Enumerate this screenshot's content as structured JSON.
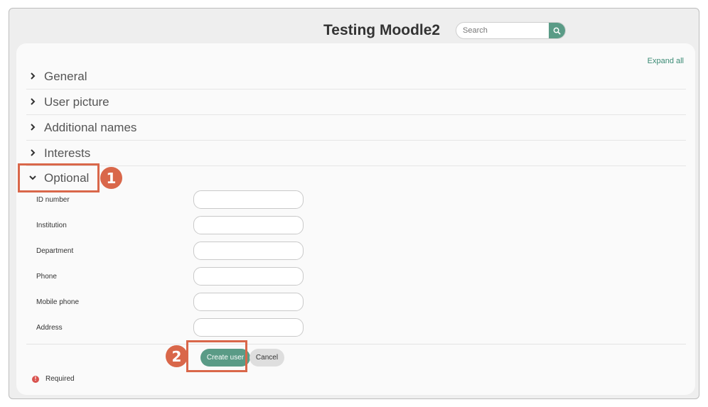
{
  "header": {
    "site_title": "Testing Moodle2",
    "search_placeholder": "Search"
  },
  "form": {
    "expand_all": "Expand all",
    "sections": [
      {
        "label": "General",
        "expanded": false
      },
      {
        "label": "User picture",
        "expanded": false
      },
      {
        "label": "Additional names",
        "expanded": false
      },
      {
        "label": "Interests",
        "expanded": false
      },
      {
        "label": "Optional",
        "expanded": true
      }
    ],
    "fields": [
      {
        "label": "ID number",
        "value": ""
      },
      {
        "label": "Institution",
        "value": ""
      },
      {
        "label": "Department",
        "value": ""
      },
      {
        "label": "Phone",
        "value": ""
      },
      {
        "label": "Mobile phone",
        "value": ""
      },
      {
        "label": "Address",
        "value": ""
      }
    ],
    "create_button": "Create user",
    "cancel_button": "Cancel",
    "required_label": "Required",
    "required_icon": "!"
  },
  "annotations": {
    "step1": "1",
    "step2": "2"
  },
  "colors": {
    "accent": "#5a9b86",
    "annotation": "#d9674a",
    "required": "#d9534f"
  }
}
